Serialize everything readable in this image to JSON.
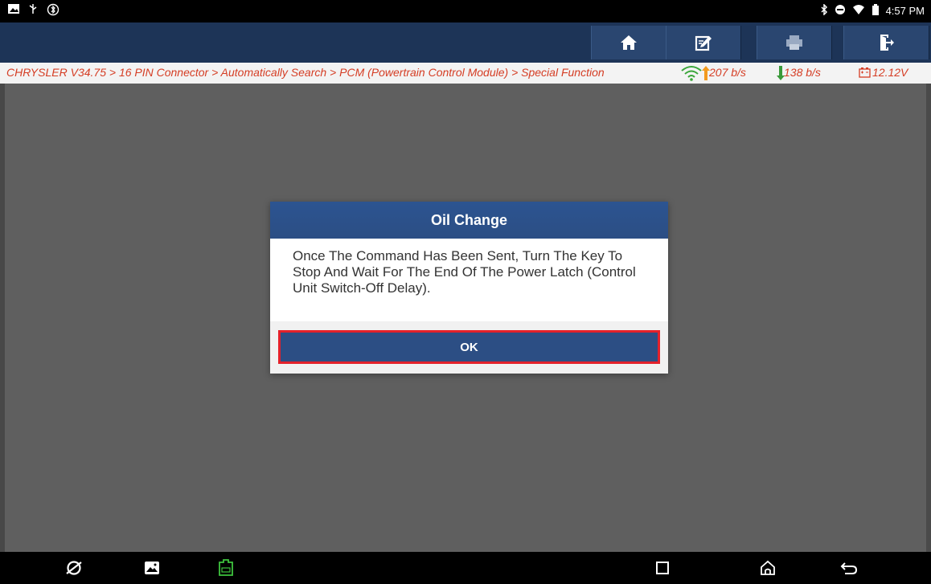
{
  "status_bar": {
    "time": "4:57 PM",
    "left_icons": [
      "image-icon",
      "usb-icon",
      "bluetooth-service-icon"
    ],
    "right_icons": [
      "bluetooth-icon",
      "do-not-disturb-icon",
      "wifi-icon",
      "battery-icon"
    ]
  },
  "toolbar": {
    "buttons": [
      "home-icon",
      "edit-icon",
      "print-icon",
      "exit-icon"
    ]
  },
  "path_bar": {
    "breadcrumb": "CHRYSLER V34.75 > 16 PIN Connector > Automatically Search > PCM (Powertrain Control Module) > Special Function",
    "upload_rate": "207 b/s",
    "download_rate": "138 b/s",
    "voltage": "12.12V"
  },
  "dialog": {
    "title": "Oil Change",
    "message": "Once The Command Has Been Sent, Turn The Key To Stop And Wait For The End Of The Power Latch (Control Unit Switch-Off Delay).",
    "ok_label": "OK"
  },
  "nav_bar": {
    "items": [
      "browser-icon",
      "gallery-icon",
      "vci-icon",
      "recent-apps-icon",
      "home-nav-icon",
      "back-icon"
    ]
  },
  "colors": {
    "toolbar": "#1d3457",
    "dialog_title": "#2c5491",
    "breadcrumb_text": "#d53d24",
    "ok_highlight": "#e3212b",
    "background": "#5f5f5f"
  }
}
